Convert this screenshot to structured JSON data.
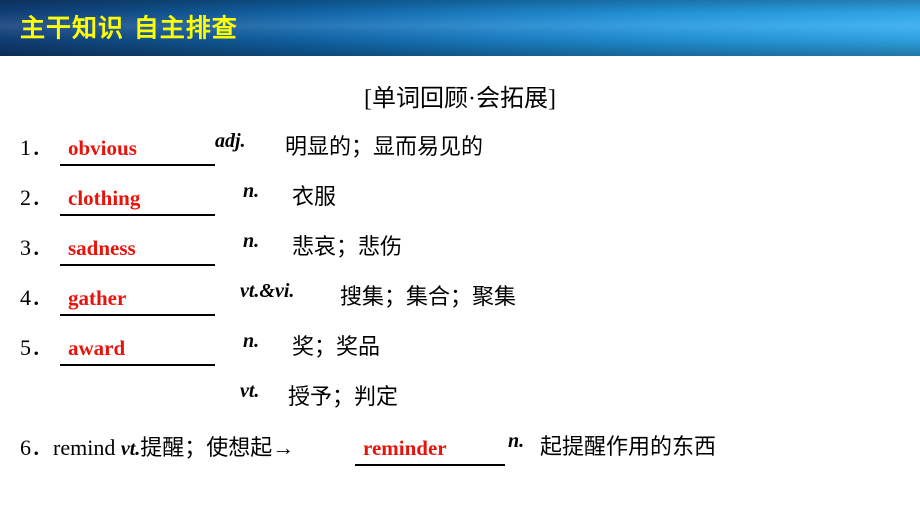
{
  "header": {
    "title": "主干知识  自主排查",
    "text_color": "#ffff00",
    "bar_color_left": "#11407a",
    "bar_color_right": "#31abee"
  },
  "section": {
    "title": "[单词回顾·会拓展]"
  },
  "answer_color": "#e8140c",
  "entries": [
    {
      "number": "1．",
      "answer": "obvious",
      "pos": "adj.",
      "definition": "明显的；显而易见的"
    },
    {
      "number": "2．",
      "answer": "clothing",
      "pos": "n.",
      "definition": "衣服"
    },
    {
      "number": "3．",
      "answer": "sadness",
      "pos": "n.",
      "definition": "悲哀；悲伤"
    },
    {
      "number": "4．",
      "answer": "gather",
      "pos": "vt.&vi.",
      "definition": "搜集；集合；聚集"
    },
    {
      "number": "5．",
      "answer": "award",
      "pos": "n.",
      "definition": "奖；奖品"
    }
  ],
  "entry5_extra": {
    "pos": "vt.",
    "definition": "授予；判定"
  },
  "entry6": {
    "number": "6．",
    "word": "remind ",
    "pos_inline": "vt.",
    "meaning": "提醒；使想起→",
    "answer": "reminder",
    "pos": "n.",
    "definition": "起提醒作用的东西"
  }
}
